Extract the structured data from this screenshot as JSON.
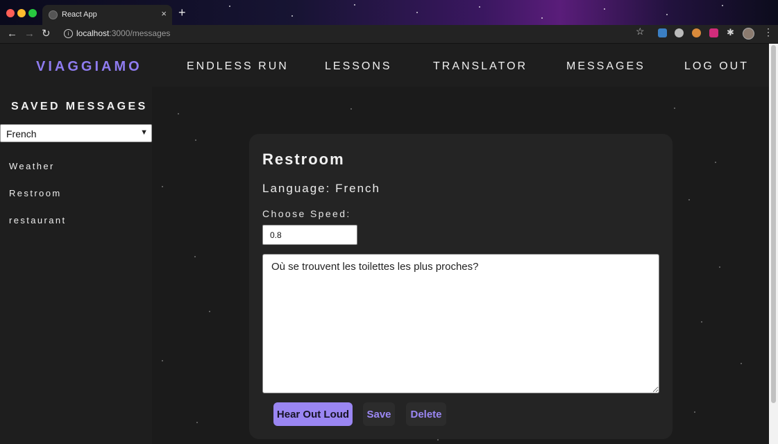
{
  "browser": {
    "tab_title": "React App",
    "tab_close": "×",
    "new_tab": "+",
    "url_host": "localhost",
    "url_path": ":3000/messages",
    "nav_back": "←",
    "nav_forward": "→",
    "nav_reload": "↻",
    "bookmark_star": "☆",
    "extensions_glyph": "✱",
    "menu_glyph": "⋮"
  },
  "header": {
    "logo": "VIAGGIAMO",
    "nav": [
      "ENDLESS RUN",
      "LESSONS",
      "TRANSLATOR",
      "MESSAGES",
      "LOG OUT"
    ]
  },
  "sidebar": {
    "title": "SAVED MESSAGES",
    "language_select": "French",
    "messages": [
      "Weather",
      "Restroom",
      "restaurant"
    ]
  },
  "card": {
    "title": "Restroom",
    "language_line": "Language: French",
    "speed_label": "Choose Speed:",
    "speed_value": "0.8",
    "message_text": "Où se trouvent les toilettes les plus proches?",
    "buttons": {
      "hear": "Hear Out Loud",
      "save": "Save",
      "delete": "Delete"
    }
  }
}
